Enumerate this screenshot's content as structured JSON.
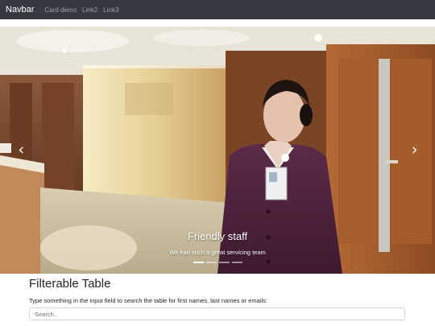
{
  "navbar": {
    "brand": "Navbar",
    "links": [
      {
        "label": "Card demo"
      },
      {
        "label": "Link2"
      },
      {
        "label": "Link3"
      }
    ]
  },
  "carousel": {
    "slide": {
      "caption_title": "Friendly staff",
      "caption_text": "We had such a great servicing team",
      "image": "woman-in-purple-uniform-photo"
    },
    "active_index": 0,
    "indicator_count": 4,
    "prev_icon": "chevron-left-icon",
    "next_icon": "chevron-right-icon"
  },
  "filter_section": {
    "title": "Filterable Table",
    "description": "Type something in the input field to search the table for first names, last names or emails:",
    "search_placeholder": "Search.."
  }
}
